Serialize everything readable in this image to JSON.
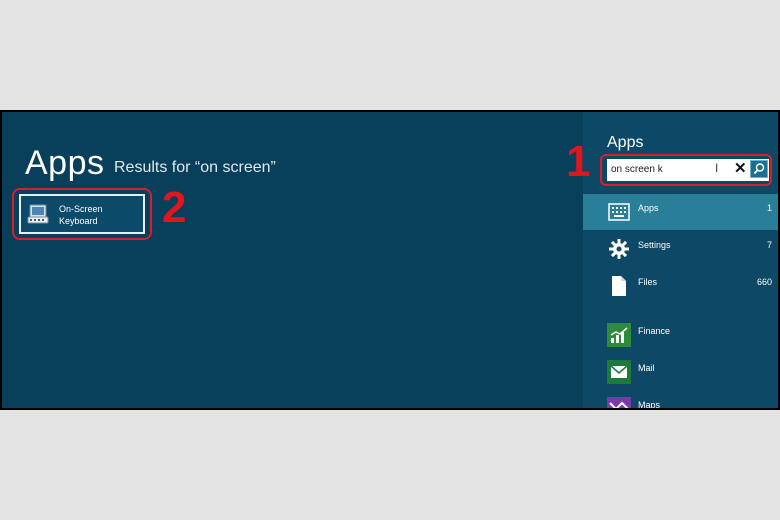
{
  "main": {
    "title": "Apps",
    "subtitle": "Results for “on screen”",
    "result_tile": {
      "label_line1": "On-Screen",
      "label_line2": "Keyboard",
      "icon": "keyboard-monitor-icon"
    }
  },
  "annotations": {
    "marker1": "1",
    "marker2": "2",
    "color": "#e2141c"
  },
  "charm": {
    "title": "Apps",
    "search": {
      "value": "on screen k",
      "clear_glyph": "✕",
      "search_icon": "search-icon"
    },
    "scopes": [
      {
        "label": "Apps",
        "count": "1",
        "icon": "keyboard-icon",
        "selected": true
      },
      {
        "label": "Settings",
        "count": "7",
        "icon": "gear-icon"
      },
      {
        "label": "Files",
        "count": "660",
        "icon": "file-icon"
      }
    ],
    "apps": [
      {
        "label": "Finance",
        "icon": "finance-icon",
        "color": "#2e8b3a"
      },
      {
        "label": "Mail",
        "icon": "mail-icon",
        "color": "#1e7a3a"
      },
      {
        "label": "Maps",
        "icon": "maps-icon",
        "color": "#7a3aa8"
      }
    ]
  },
  "colors": {
    "main_bg": "#083f5b",
    "charm_bg": "#0d4866",
    "selected_bg": "#2a7f98"
  }
}
